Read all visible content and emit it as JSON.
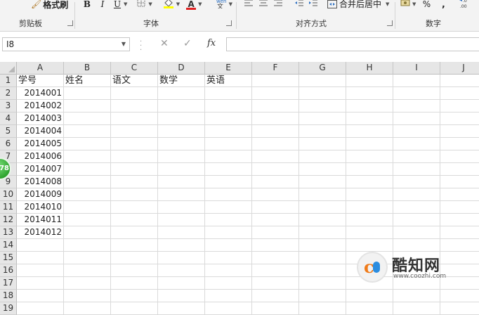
{
  "ribbon": {
    "clipboard": {
      "format_painter_label": "格式刷",
      "group_label": "剪贴板"
    },
    "font": {
      "bold": "B",
      "italic": "I",
      "underline": "U",
      "font_color": "A",
      "group_label": "字体"
    },
    "alignment": {
      "merge_center_label": "合并后居中",
      "group_label": "对齐方式"
    },
    "number": {
      "percent": "%",
      "comma": ",",
      "group_label": "数字"
    }
  },
  "formula_bar": {
    "name_box": "I8",
    "cancel_symbol": "✕",
    "enter_symbol": "✓",
    "fx_label": "fx",
    "formula_value": ""
  },
  "sheet": {
    "columns": [
      "A",
      "B",
      "C",
      "D",
      "E",
      "F",
      "G",
      "H",
      "I",
      "J"
    ],
    "rows": [
      "1",
      "2",
      "3",
      "4",
      "5",
      "6",
      "7",
      "8",
      "9",
      "10",
      "11",
      "12",
      "13",
      "14",
      "15",
      "16",
      "17",
      "18",
      "19"
    ],
    "headers": [
      "学号",
      "姓名",
      "语文",
      "数学",
      "英语"
    ],
    "ids": [
      "2014001",
      "2014002",
      "2014003",
      "2014004",
      "2014005",
      "2014006",
      "2014007",
      "2014008",
      "2014009",
      "2014010",
      "2014011",
      "2014012"
    ]
  },
  "overlays": {
    "badge_text": "78",
    "watermark_name": "酷知网",
    "watermark_url": "www.coozhi.com"
  }
}
